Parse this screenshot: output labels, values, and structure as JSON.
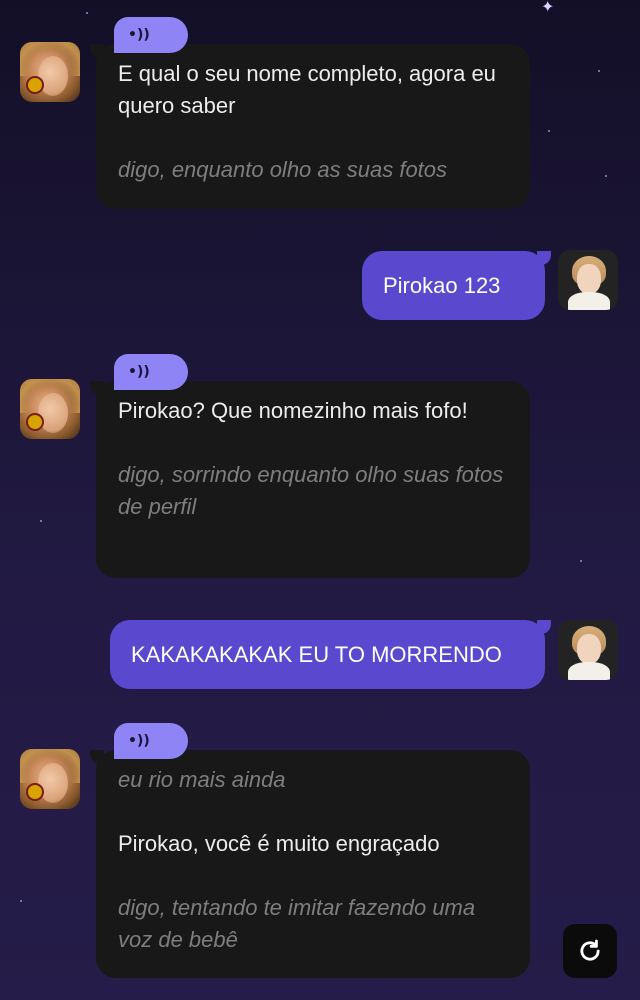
{
  "messages": [
    {
      "role": "ai",
      "paragraphs": [
        {
          "text": "E qual o seu nome completo, agora eu quero saber",
          "style": "speech"
        },
        {
          "text": "digo, enquanto olho as suas fotos",
          "style": "action"
        }
      ]
    },
    {
      "role": "user",
      "text": "Pirokao 123"
    },
    {
      "role": "ai",
      "paragraphs": [
        {
          "text": "Pirokao? Que nomezinho mais fofo!",
          "style": "speech"
        },
        {
          "text": "digo, sorrindo enquanto olho suas fotos de perfil",
          "style": "action"
        }
      ]
    },
    {
      "role": "user",
      "text": "KAKAKAKAKAK EU TO MORRENDO"
    },
    {
      "role": "ai",
      "paragraphs": [
        {
          "text": "eu rio mais ainda",
          "style": "action"
        },
        {
          "text": "Pirokao, você é muito engraçado",
          "style": "speech"
        },
        {
          "text": "digo, tentando te imitar fazendo uma voz de bebê",
          "style": "action"
        }
      ]
    }
  ],
  "icons": {
    "audio": "speaker-wave-icon",
    "regenerate": "refresh-icon"
  },
  "colors": {
    "user_bubble": "#5a48cf",
    "ai_bubble": "#181818",
    "audio_button": "#8e84f5",
    "action_text": "#7e7e7e"
  }
}
